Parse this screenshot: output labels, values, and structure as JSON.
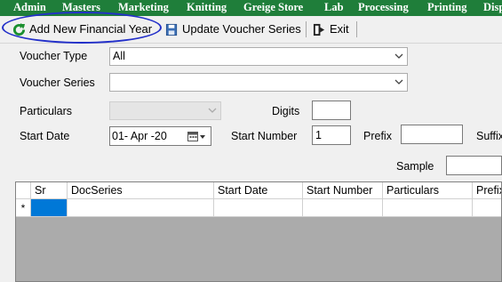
{
  "menubar": {
    "items": [
      "Admin",
      "Masters",
      "Marketing",
      "Knitting",
      "Greige Store",
      "Lab",
      "Processing",
      "Printing",
      "Disp"
    ]
  },
  "toolbar": {
    "add_fy_label": "Add New Financial Year",
    "update_series_label": "Update Voucher Series",
    "exit_label": "Exit"
  },
  "form": {
    "voucher_type": {
      "label": "Voucher Type",
      "value": "All"
    },
    "voucher_series": {
      "label": "Voucher Series",
      "value": ""
    },
    "particulars": {
      "label": "Particulars",
      "value": ""
    },
    "digits": {
      "label": "Digits",
      "value": ""
    },
    "start_date": {
      "label": "Start Date",
      "value": "01- Apr -20"
    },
    "start_number": {
      "label": "Start Number",
      "value": "1"
    },
    "prefix": {
      "label": "Prefix",
      "value": ""
    },
    "suffix": {
      "label": "Suffix",
      "value": ""
    },
    "sample": {
      "label": "Sample",
      "value": ""
    }
  },
  "grid": {
    "columns": [
      "Sr",
      "DocSeries",
      "Start Date",
      "Start Number",
      "Particulars",
      "Prefix"
    ],
    "new_row_marker": "*"
  },
  "colors": {
    "menubar_bg": "#1f7e3a",
    "highlight_oval": "#2330c9",
    "selected_cell": "#0078d7"
  },
  "icons": {
    "add_fy": "refresh-green-icon",
    "update_series": "save-disk-icon",
    "exit": "exit-door-icon"
  }
}
